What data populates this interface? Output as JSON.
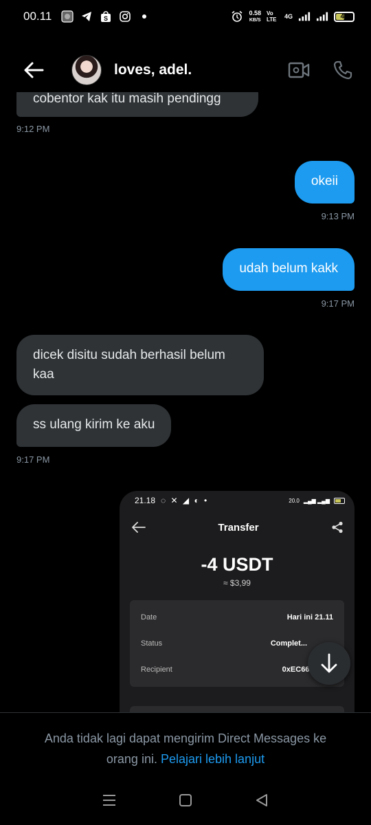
{
  "status_bar": {
    "time": "00.11",
    "net_speed": "0.58",
    "net_unit": "KB/S",
    "volte": "Vo LTE",
    "network": "4G",
    "battery": "47",
    "icons": [
      "gallery-icon",
      "telegram-icon",
      "shopee-icon",
      "instagram-icon",
      "dot-icon",
      "alarm-icon",
      "signal-icon"
    ]
  },
  "header": {
    "contact_name": "loves, adel."
  },
  "messages": [
    {
      "side": "in",
      "text": "cobentor kak itu masih pendingg",
      "time": "9:12 PM"
    },
    {
      "side": "out",
      "text": "okeii",
      "time": "9:13 PM"
    },
    {
      "side": "out",
      "text": "udah belum kakk",
      "time": "9:17 PM"
    },
    {
      "side": "in",
      "text": "dicek disitu sudah berhasil belum kaa"
    },
    {
      "side": "in",
      "text": "ss ulang kirim ke aku",
      "time": "9:17 PM"
    }
  ],
  "screenshot": {
    "time": "21.18",
    "net": "20.0",
    "title": "Transfer",
    "amount": "-4 USDT",
    "approx": "≈ $3,99",
    "rows": [
      {
        "key": "Date",
        "value": "Hari ini 21.11"
      },
      {
        "key": "Status",
        "value": "Complet..."
      },
      {
        "key": "Recipient",
        "value": "0xEC664...9..."
      }
    ]
  },
  "footer": {
    "notice": "Anda tidak lagi dapat mengirim Direct Messages ke orang ini.",
    "link": "Pelajari lebih lanjut"
  },
  "colors": {
    "background": "#000000",
    "incoming_bubble": "#2f3336",
    "outgoing_bubble": "#1d9bf0",
    "link": "#1d9bf0",
    "muted_text": "#8b98a5"
  }
}
